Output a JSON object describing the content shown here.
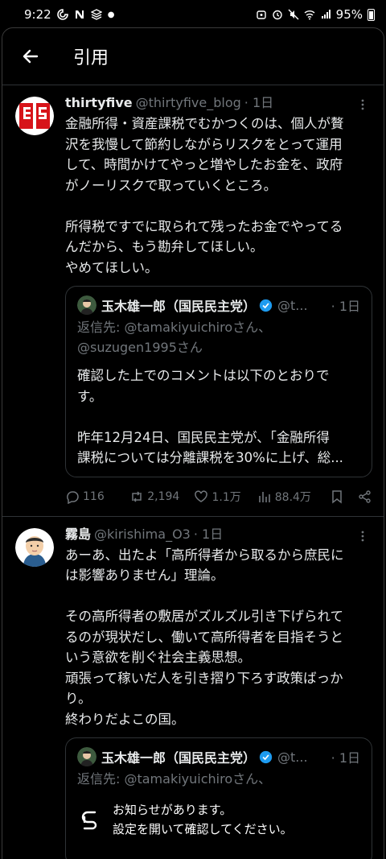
{
  "status": {
    "time": "9:22",
    "battery": "95%"
  },
  "header": {
    "title": "引用"
  },
  "posts": [
    {
      "name": "thirtyfive",
      "handle": "@thirtyfive_blog",
      "time": "· 1日",
      "body": "金融所得・資産課税でむかつくのは、個人が贅\n沢を我慢して節約しながらリスクをとって運用\nして、時間かけてやっと増やしたお金を、政府\nがノーリスクで取っていくところ。\n\n所得税ですでに取られて残ったお金でやってる\nんだから、もう勘弁してほしい。\nやめてほしい。",
      "quote": {
        "name": "玉木雄一郎（国民民主党）",
        "handle": "@t...",
        "time": "· 1日",
        "reply_to": "返信先: @tamakiyuichiroさん、\n@suzugen1995さん",
        "body": "確認した上でのコメントは以下のとおりで\nす。\n\n昨年12月24日、国民民主党が、「金融所得\n課税については分離課税を30%に上げ、総..."
      },
      "actions": {
        "replies": "116",
        "reposts": "2,194",
        "likes": "1.1万",
        "views": "88.4万"
      }
    },
    {
      "name": "霧島",
      "handle": "@kirishima_O3",
      "time": "· 1日",
      "body": "あーあ、出たよ「高所得者から取るから庶民に\nは影響ありません」理論。\n\nその高所得者の敷居がズルズル引き下げられて\nるのが現状だし、働いて高所得者を目指そうと\nいう意欲を削ぐ社会主義思想。\n頑張って稼いだ人を引き摺り下ろす政策ばっか\nり。\n終わりだよこの国。",
      "quote": {
        "name": "玉木雄一郎（国民民主党）",
        "handle": "@t...",
        "time": "· 1日",
        "reply_to": "返信先: @tamakiyuichiroさん、\n@suzugen1995さん"
      }
    }
  ],
  "toast": {
    "line1": "お知らせがあります。",
    "line2": "設定を開いて確認してください。"
  },
  "colors": {
    "background": "#000000",
    "text": "#e7e9ea",
    "muted": "#71767b",
    "verified": "#1d9bf0",
    "divider": "#2f3336"
  }
}
